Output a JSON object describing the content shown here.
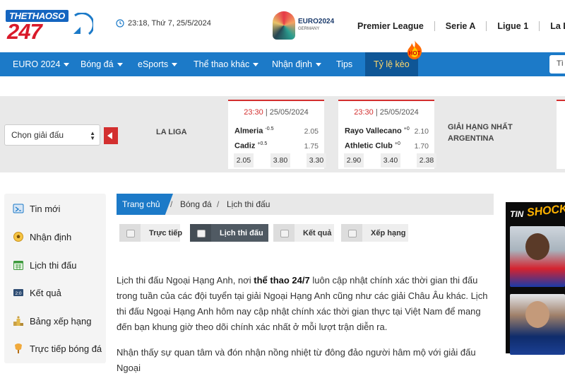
{
  "header": {
    "logo_top": "THETHAOSO",
    "logo_bottom": "247",
    "datetime": "23:18, Thứ 7, 25/5/2024",
    "euro_logo": {
      "title": "EURO2024",
      "subtitle": "GERMANY",
      "icon": "euro-2024-trophy-icon"
    },
    "leagues": [
      "Premier League",
      "Serie A",
      "Ligue 1",
      "La Liga"
    ]
  },
  "nav": {
    "items": [
      {
        "label": "EURO 2024",
        "dropdown": true
      },
      {
        "label": "Bóng đá",
        "dropdown": true
      },
      {
        "label": "eSports",
        "dropdown": true
      },
      {
        "label": "Thể thao khác",
        "dropdown": true
      },
      {
        "label": "Nhận định",
        "dropdown": true
      },
      {
        "label": "Tips",
        "dropdown": false
      },
      {
        "label": "Tỷ lệ kèo",
        "dropdown": false,
        "active": true
      }
    ],
    "hot_badge": "HOT",
    "search_text": "Tì",
    "colors": {
      "bar": "#1c7ac8",
      "active_bg": "#0f5696",
      "active_text": "#ffd86b"
    }
  },
  "odds_bar": {
    "select_label": "Chọn giải đấu",
    "league": "LA LIGA",
    "matches": [
      {
        "date_time": "23:30",
        "date": "| 25/05/2024",
        "home": "Almeria",
        "home_hcp": "-0.5",
        "home_odd": "2.05",
        "away": "Cadiz",
        "away_hcp": "+0.5",
        "away_odd": "1.75",
        "odds": [
          "2.05",
          "3.80",
          "3.30"
        ]
      },
      {
        "date_time": "23:30",
        "date": "| 25/05/2024",
        "home": "Rayo Vallecano",
        "home_hcp": "+0",
        "home_odd": "2.10",
        "away": "Athletic Club",
        "away_hcp": "+0",
        "away_odd": "1.70",
        "odds": [
          "2.90",
          "3.40",
          "2.38"
        ]
      }
    ],
    "next_league_line1": "GIẢI HẠNG NHẤT",
    "next_league_line2": "ARGENTINA"
  },
  "sidebar": {
    "items": [
      {
        "label": "Tin mới",
        "icon": "news-icon"
      },
      {
        "label": "Nhận định",
        "icon": "football-icon"
      },
      {
        "label": "Lịch thi đấu",
        "icon": "calendar-icon"
      },
      {
        "label": "Kết quả",
        "icon": "scoreboard-icon"
      },
      {
        "label": "Bảng xếp hạng",
        "icon": "podium-icon"
      },
      {
        "label": "Trực tiếp bóng đá",
        "icon": "live-icon"
      }
    ]
  },
  "breadcrumb": {
    "home": "Trang chủ",
    "level1": "Bóng đá",
    "level2": "Lịch thi đấu",
    "sep": "/"
  },
  "tabs": [
    {
      "label": "Trực tiếp",
      "active": false
    },
    {
      "label": "Lịch thi đấu",
      "active": true
    },
    {
      "label": "Kết quả",
      "active": false
    },
    {
      "label": "Xếp hạng",
      "active": false
    }
  ],
  "article": {
    "p1_before": "Lịch thi đấu Ngoại Hạng Anh, nơi ",
    "p1_bold": "thể thao 24/7",
    "p1_after": " luôn cập nhật chính xác thời gian thi đấu trong tuần của các đội tuyển tại giải Ngoại Hạng Anh cũng như các giải Châu Âu khác. Lịch thi đấu Ngoại Hạng Anh hôm nay cập nhật chính xác thời gian thực tại Việt Nam để mang đến bạn khung giờ theo dõi chính xác nhất ở mỗi lượt trận diễn ra.",
    "p2": "Nhận thấy sự quan tâm và đón nhận nồng nhiệt từ đông đảo người hâm mộ với giải đấu Ngoại"
  },
  "ad": {
    "label_tin": "TIN",
    "label_shock": "SHOCK"
  }
}
